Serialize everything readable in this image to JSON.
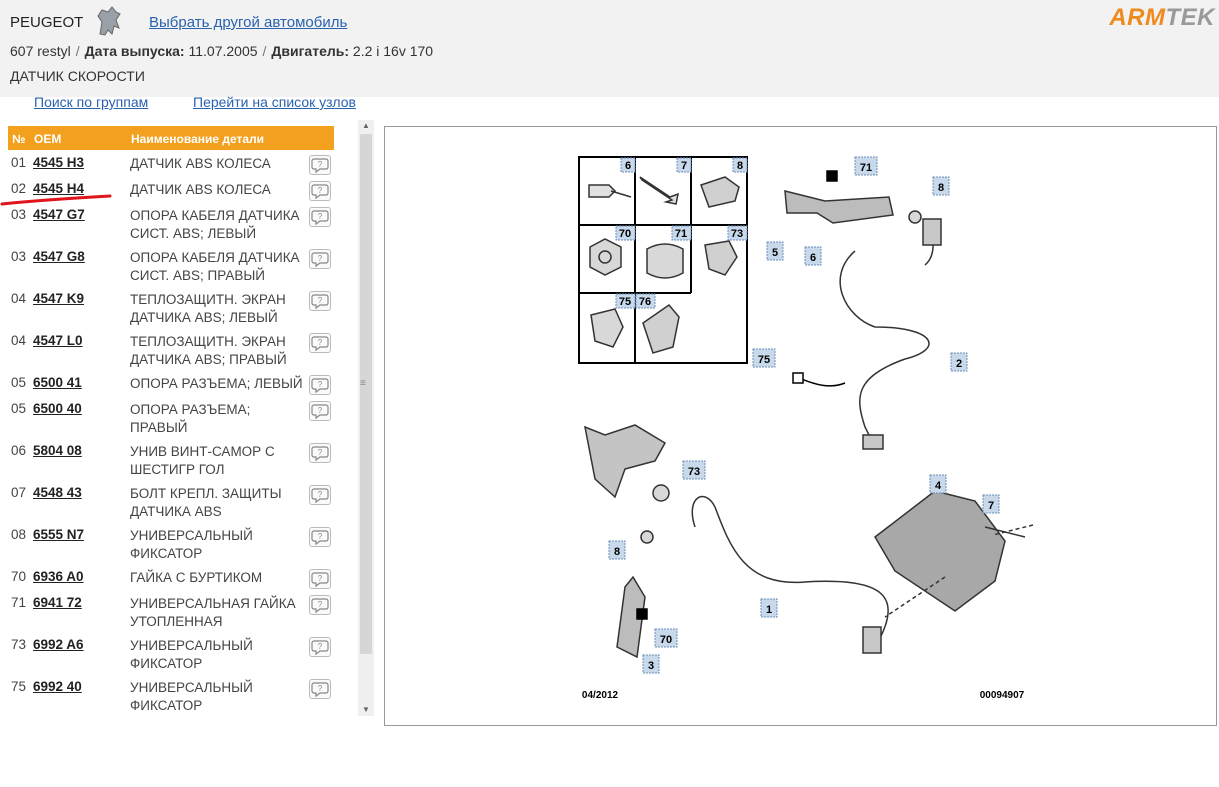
{
  "header": {
    "brand": "PEUGEOT",
    "change_car_link": "Выбрать другой автомобиль",
    "logo_text_orange": "ARM",
    "logo_text_gray": "TEK",
    "model": "607 restyl",
    "release_label": "Дата выпуска:",
    "release_date": "11.07.2005",
    "engine_label": "Двигатель:",
    "engine": "2.2 i 16v 170",
    "group_title": "ДАТЧИК СКОРОСТИ"
  },
  "nav": {
    "search_groups": "Поиск по группам",
    "units_list": "Перейти на список узлов"
  },
  "table": {
    "col_num": "№",
    "col_oem": "OEM",
    "col_name": "Наименование детали",
    "rows": [
      {
        "num": "01",
        "oem": "4545 H3",
        "name": "ДАТЧИК ABS КОЛЕСА"
      },
      {
        "num": "02",
        "oem": "4545 H4",
        "name": "ДАТЧИК ABS КОЛЕСА"
      },
      {
        "num": "03",
        "oem": "4547 G7",
        "name": "ОПОРА КАБЕЛЯ ДАТЧИКА СИСТ. ABS; ЛЕВЫЙ"
      },
      {
        "num": "03",
        "oem": "4547 G8",
        "name": "ОПОРА КАБЕЛЯ ДАТЧИКА СИСТ. ABS; ПРАВЫЙ"
      },
      {
        "num": "04",
        "oem": "4547 K9",
        "name": "ТЕПЛОЗАЩИТН. ЭКРАН ДАТЧИКА ABS; ЛЕВЫЙ"
      },
      {
        "num": "04",
        "oem": "4547 L0",
        "name": "ТЕПЛОЗАЩИТН. ЭКРАН ДАТЧИКА ABS; ПРАВЫЙ"
      },
      {
        "num": "05",
        "oem": "6500 41",
        "name": "ОПОРА РАЗЪЕМА; ЛЕВЫЙ"
      },
      {
        "num": "05",
        "oem": "6500 40",
        "name": "ОПОРА РАЗЪЕМА; ПРАВЫЙ"
      },
      {
        "num": "06",
        "oem": "5804 08",
        "name": "УНИВ ВИНТ-САМОР С ШЕСТИГР ГОЛ"
      },
      {
        "num": "07",
        "oem": "4548 43",
        "name": "БОЛТ КРЕПЛ. ЗАЩИТЫ ДАТЧИКА ABS"
      },
      {
        "num": "08",
        "oem": "6555 N7",
        "name": "УНИВЕРСАЛЬНЫЙ ФИКСАТОР"
      },
      {
        "num": "70",
        "oem": "6936 A0",
        "name": "ГАЙКА С БУРТИКОМ"
      },
      {
        "num": "71",
        "oem": "6941 72",
        "name": "УНИВЕРСАЛЬНАЯ ГАЙКА УТОПЛЕННАЯ"
      },
      {
        "num": "73",
        "oem": "6992 A6",
        "name": "УНИВЕРСАЛЬНЫЙ ФИКСАТОР"
      },
      {
        "num": "75",
        "oem": "6992 40",
        "name": "УНИВЕРСАЛЬНЫЙ ФИКСАТОР"
      }
    ]
  },
  "diagram": {
    "date": "04/2012",
    "code": "00094907",
    "legend_labels": [
      "6",
      "7",
      "8",
      "70",
      "71",
      "73",
      "75",
      "76"
    ],
    "callouts": [
      "1",
      "2",
      "3",
      "4",
      "5",
      "6",
      "7",
      "8",
      "8",
      "70",
      "71",
      "73",
      "75"
    ]
  },
  "colors": {
    "accent": "#f3a01e",
    "link": "#2a62b0",
    "callout_fill": "#c9d9ec"
  }
}
